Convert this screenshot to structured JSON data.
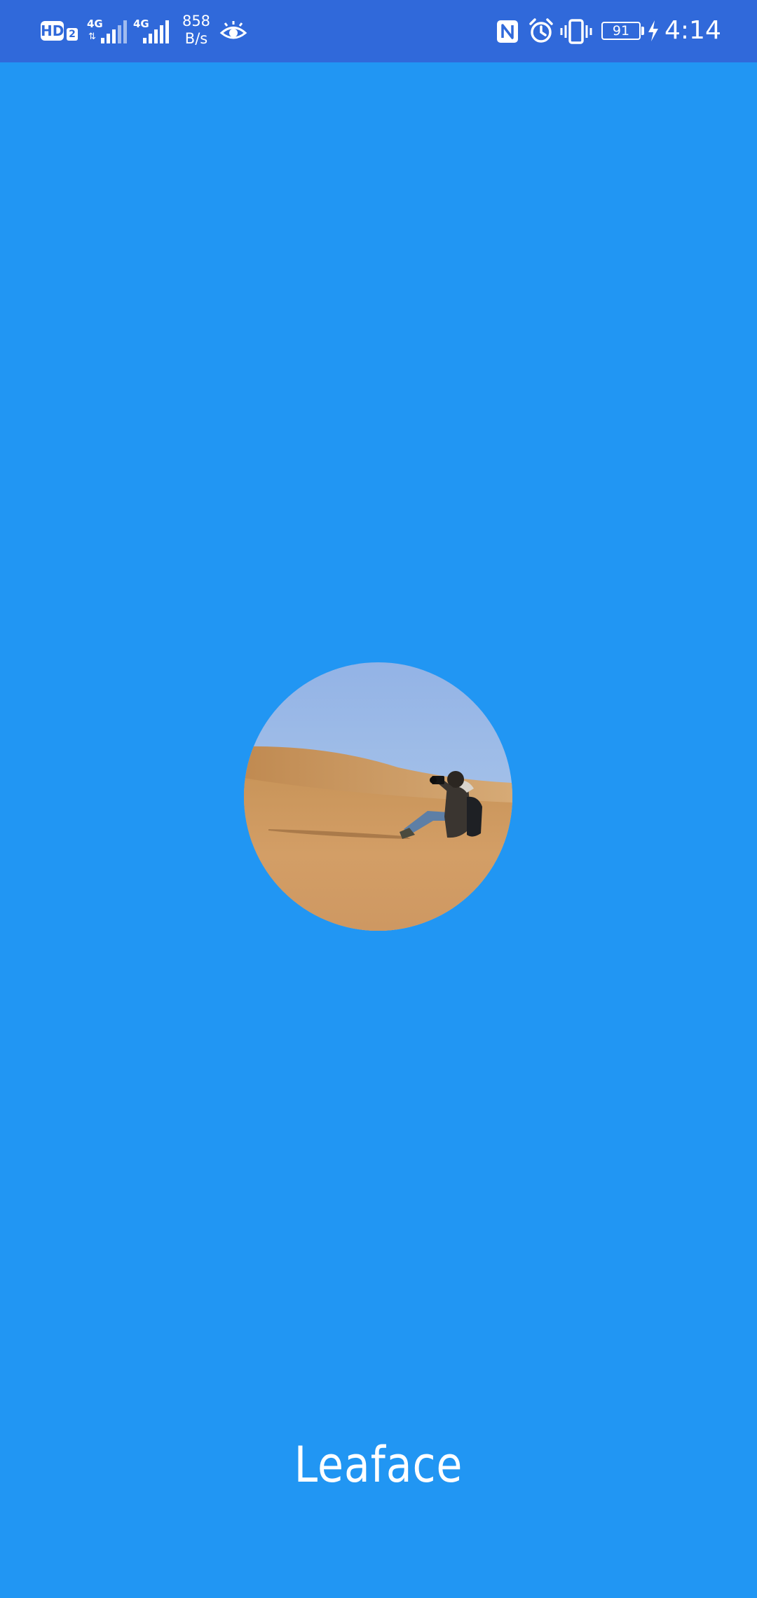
{
  "status_bar": {
    "hd_label": "HD",
    "hd_sim": "2",
    "sim1_network": "4G",
    "sim1_arrows": "⇅",
    "sim2_network": "4G",
    "speed_value": "858",
    "speed_unit": "B/s",
    "battery_level": "91",
    "time": "4:14",
    "icons": [
      "hd-icon",
      "signal-icon",
      "signal-icon",
      "eye-icon",
      "nfc-icon",
      "alarm-icon",
      "vibrate-icon",
      "battery-icon",
      "charging-icon"
    ]
  },
  "splash": {
    "app_name": "Leaface"
  },
  "colors": {
    "background": "#2196F3",
    "status_bar": "#3069DA",
    "text": "#FFFFFF"
  }
}
